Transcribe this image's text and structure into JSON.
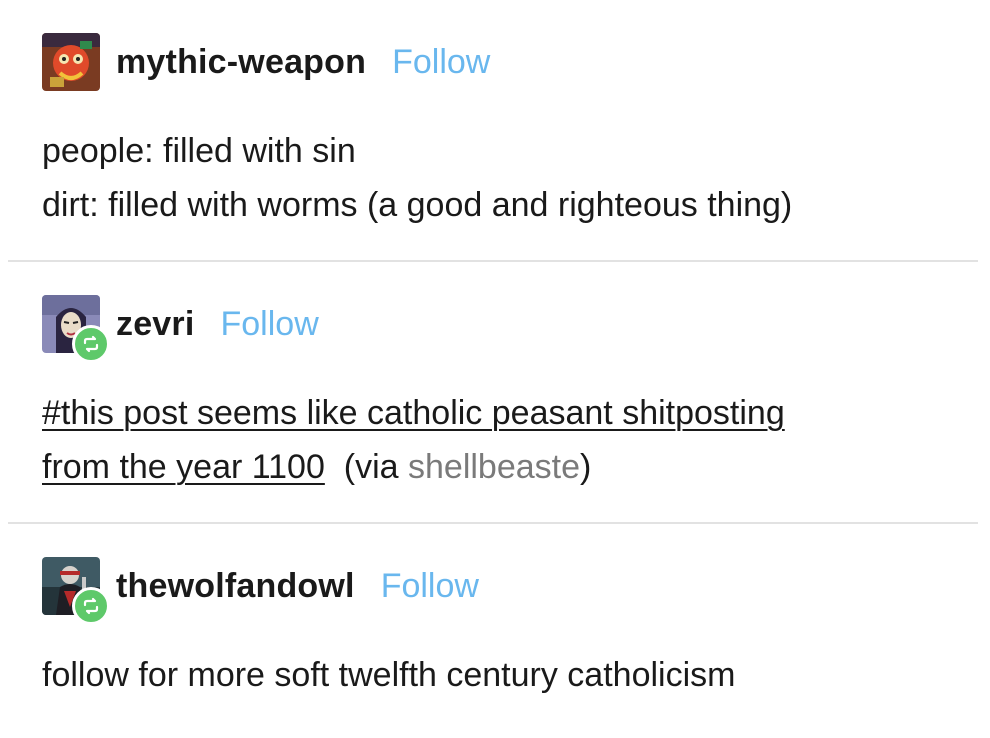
{
  "posts": [
    {
      "username": "mythic-weapon",
      "follow_label": "Follow",
      "avatar_icon": "mythic-weapon-avatar",
      "reblogged": false,
      "lines": [
        "people: filled with sin",
        "dirt: filled with worms (a good and righteous thing)"
      ]
    },
    {
      "username": "zevri",
      "follow_label": "Follow",
      "avatar_icon": "zevri-avatar",
      "reblogged": true,
      "tag_line_1": "#this post seems like catholic peasant shitposting",
      "tag_line_2": "from the year 1100",
      "via_prefix": "(via ",
      "via_user": "shellbeaste",
      "via_suffix": ")"
    },
    {
      "username": "thewolfandowl",
      "follow_label": "Follow",
      "avatar_icon": "thewolfandowl-avatar",
      "reblogged": true,
      "lines": [
        "follow for more soft twelfth century catholicism"
      ]
    }
  ],
  "colors": {
    "follow": "#69b7ee",
    "reblog_badge": "#5ec96a",
    "divider": "#e2e2e2",
    "via": "#7a7a7a"
  }
}
